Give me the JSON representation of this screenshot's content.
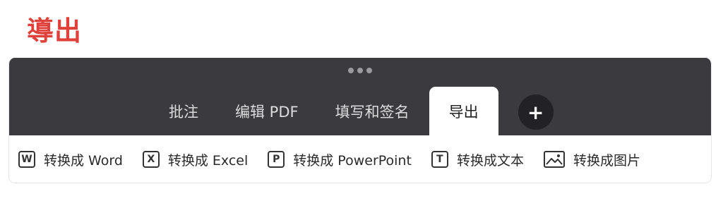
{
  "heading": "導出",
  "tabs": [
    {
      "label": "批注",
      "active": false
    },
    {
      "label": "编辑 PDF",
      "active": false
    },
    {
      "label": "填写和签名",
      "active": false
    },
    {
      "label": "导出",
      "active": true
    }
  ],
  "add_tab": {
    "icon": "plus-icon",
    "symbol": "+"
  },
  "toolbar": [
    {
      "label": "转换成 Word",
      "icon": "word-icon",
      "glyph": "W"
    },
    {
      "label": "转换成 Excel",
      "icon": "excel-icon",
      "glyph": "X"
    },
    {
      "label": "转换成 PowerPoint",
      "icon": "powerpoint-icon",
      "glyph": "P"
    },
    {
      "label": "转换成文本",
      "icon": "text-icon",
      "glyph": "T"
    },
    {
      "label": "转换成图片",
      "icon": "image-icon",
      "glyph": ""
    }
  ],
  "colors": {
    "heading": "#e0403a",
    "topbar": "#3b3a3f",
    "add_button": "#222226"
  }
}
